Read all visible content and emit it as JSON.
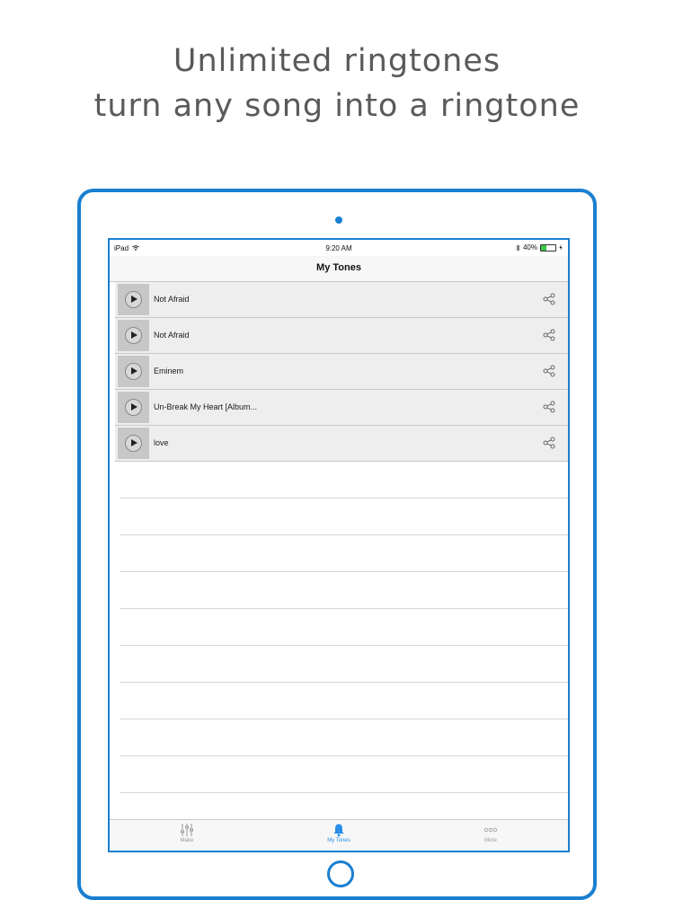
{
  "promo": {
    "line1": "Unlimited ringtones",
    "line2": "turn any song into a ringtone"
  },
  "status_bar": {
    "device": "iPad",
    "time": "9:20 AM",
    "battery": "40%",
    "battery_level": 0.4
  },
  "nav": {
    "title": "My Tones"
  },
  "tones": [
    {
      "title": "Not Afraid"
    },
    {
      "title": "Not Afraid"
    },
    {
      "title": "Eminem"
    },
    {
      "title": "Un-Break My Heart [Album..."
    },
    {
      "title": "love"
    }
  ],
  "tabs": [
    {
      "label": "Make",
      "icon": "sliders-icon"
    },
    {
      "label": "My Tones",
      "icon": "bell-icon"
    },
    {
      "label": "More",
      "icon": "more-icon"
    }
  ],
  "colors": {
    "accent": "#1a7fd0",
    "tab_active": "#2b8ee8",
    "battery": "#3fc34a"
  }
}
